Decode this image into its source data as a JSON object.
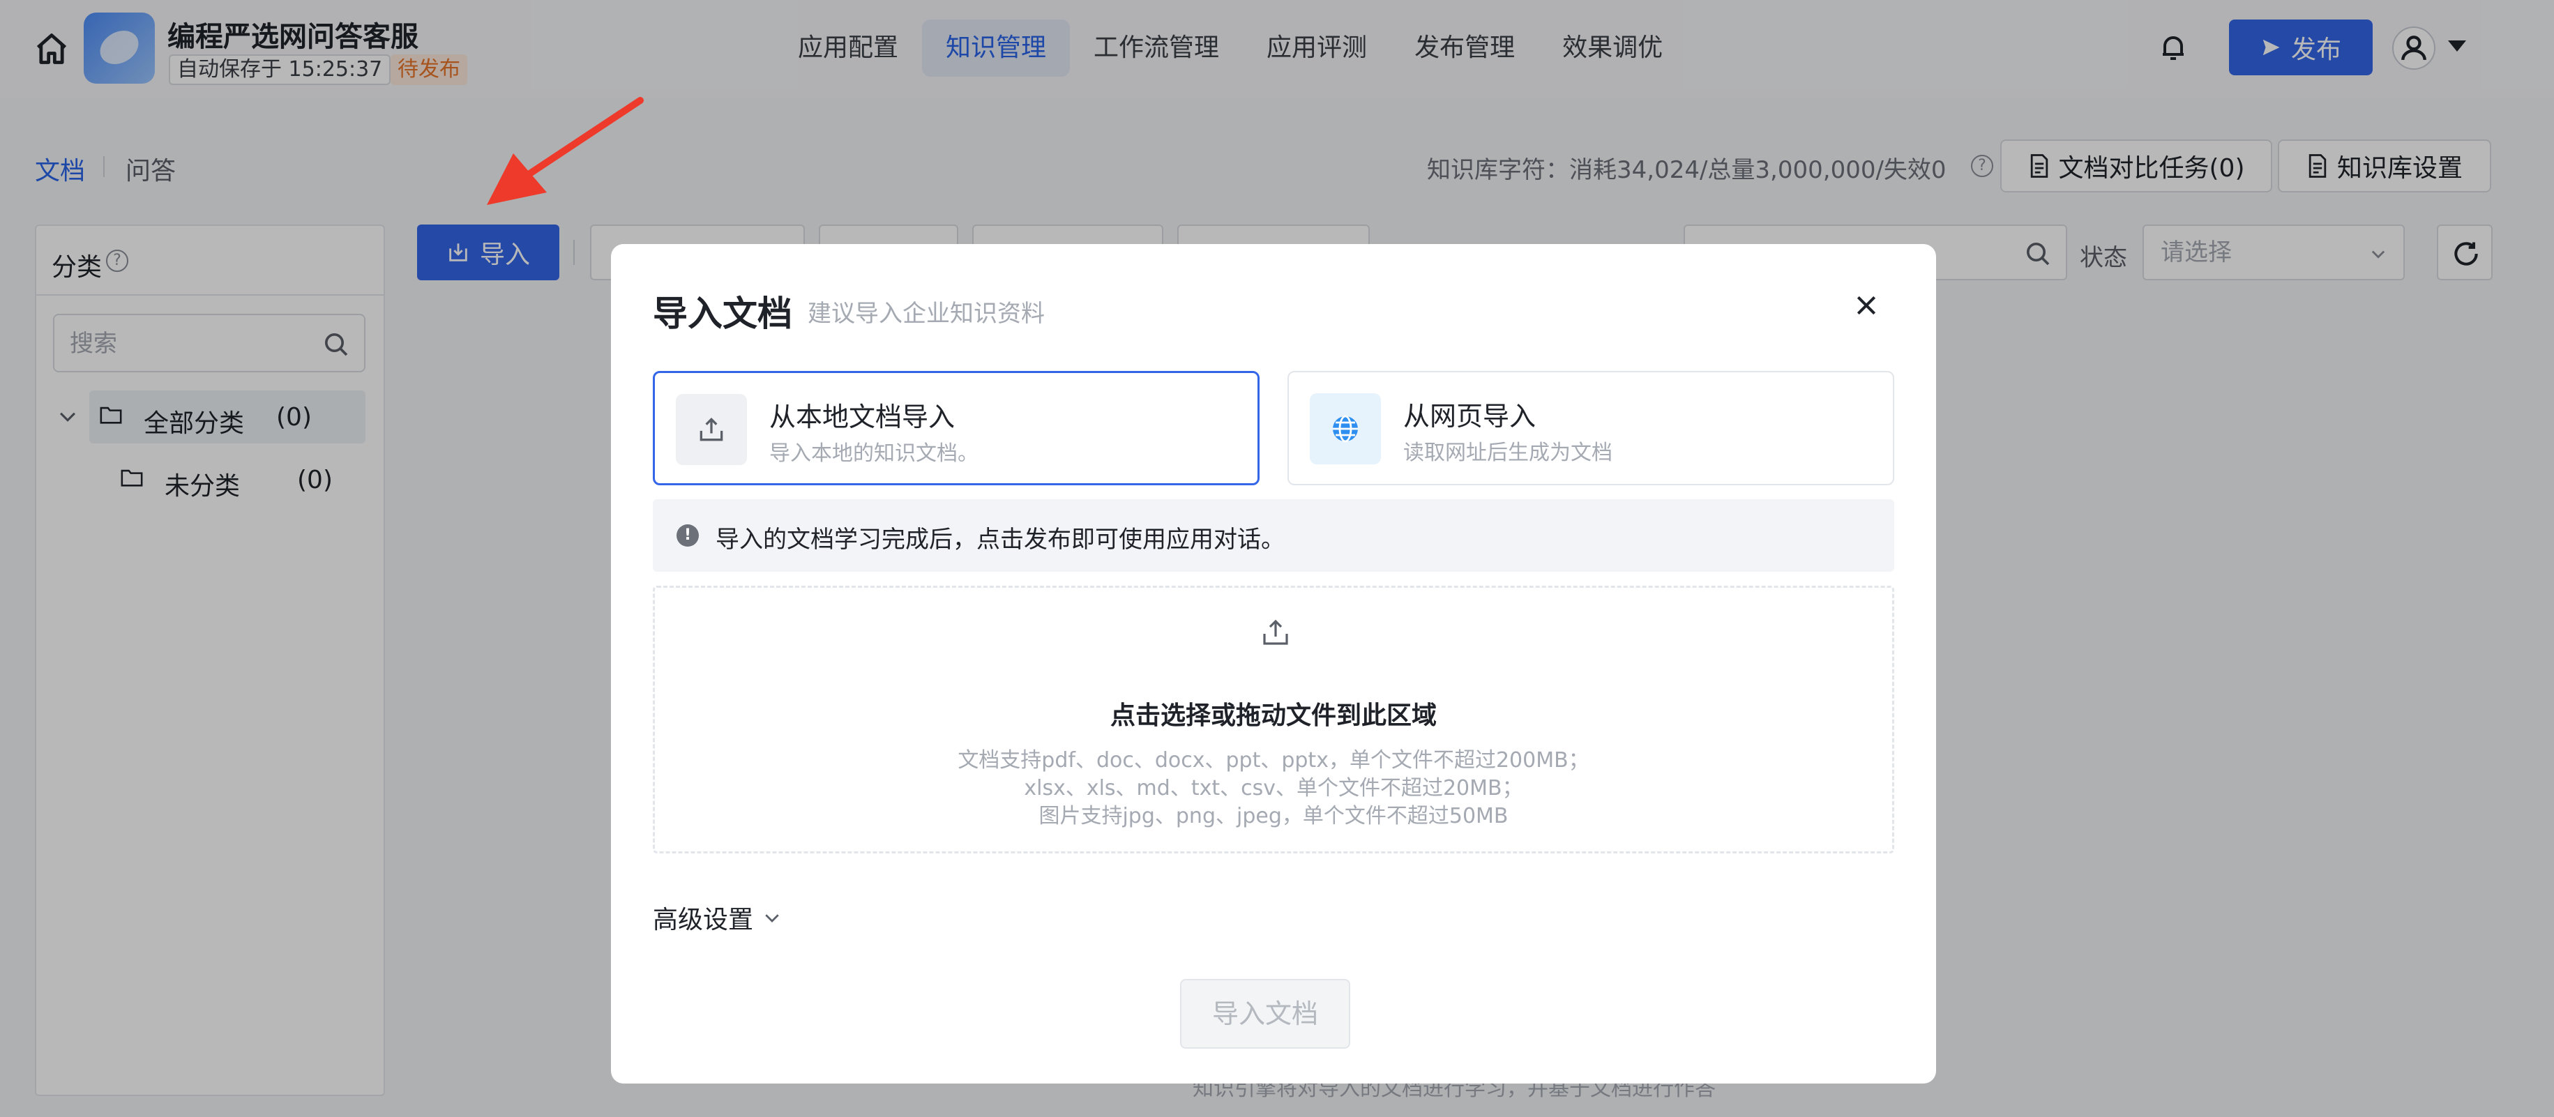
{
  "header": {
    "app_title": "编程严选网问答客服",
    "autosave": "自动保存于 15:25:37",
    "status": "待发布",
    "nav": [
      {
        "label": "应用配置",
        "active": false
      },
      {
        "label": "知识管理",
        "active": true
      },
      {
        "label": "工作流管理",
        "active": false
      },
      {
        "label": "应用评测",
        "active": false
      },
      {
        "label": "发布管理",
        "active": false
      },
      {
        "label": "效果调优",
        "active": false
      }
    ],
    "publish_label": "发布"
  },
  "subbar": {
    "tabs": [
      {
        "label": "文档",
        "active": true
      },
      {
        "label": "问答",
        "active": false
      }
    ],
    "kb_stats": "知识库字符：消耗34,024/总量3,000,000/失效0",
    "compare_btn": "文档对比任务(0)",
    "settings_btn": "知识库设置"
  },
  "left_panel": {
    "title": "分类",
    "search_placeholder": "搜索",
    "tree": [
      {
        "label": "全部分类",
        "count": "(0)"
      },
      {
        "label": "未分类",
        "count": "(0)"
      }
    ]
  },
  "toolbar": {
    "import_label": "导入",
    "status_label": "状态",
    "status_placeholder": "请选择"
  },
  "bottom_hint": "知识引擎将对导入的文档进行学习，并基于文档进行作答",
  "modal": {
    "title": "导入文档",
    "subtitle": "建议导入企业知识资料",
    "sources": [
      {
        "title": "从本地文档导入",
        "desc": "导入本地的知识文档。",
        "selected": true
      },
      {
        "title": "从网页导入",
        "desc": "读取网址后生成为文档",
        "selected": false
      }
    ],
    "notice": "导入的文档学习完成后，点击发布即可使用应用对话。",
    "dropzone": {
      "title": "点击选择或拖动文件到此区域",
      "lines": [
        "文档支持pdf、doc、docx、ppt、pptx，单个文件不超过200MB；",
        "xlsx、xls、md、txt、csv、单个文件不超过20MB；",
        "图片支持jpg、png、jpeg，单个文件不超过50MB"
      ]
    },
    "advanced": "高级设置",
    "submit": "导入文档"
  },
  "colors": {
    "primary": "#3366e8",
    "pending_text": "#e8732a",
    "pending_bg": "#fde9dc",
    "annotation_arrow": "#ee3a2a"
  }
}
